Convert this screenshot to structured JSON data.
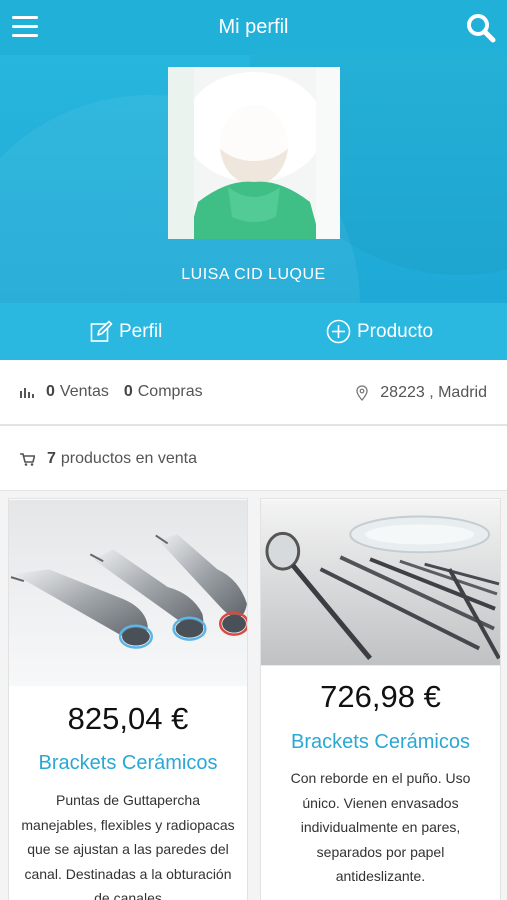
{
  "header": {
    "title": "Mi perfil"
  },
  "profile": {
    "name": "LUISA CID LUQUE"
  },
  "actions": {
    "perfil_label": "Perfil",
    "producto_label": "Producto"
  },
  "stats": {
    "ventas_count": "0",
    "ventas_label": "Ventas",
    "compras_count": "0",
    "compras_label": "Compras",
    "location": "28223 , Madrid"
  },
  "products_summary": {
    "count": "7",
    "label": "productos en venta"
  },
  "products": [
    {
      "price": "825,04 €",
      "title": "Brackets Cerámicos",
      "description": "Puntas de Guttapercha manejables, flexibles y radiopacas que se ajustan a las paredes del canal. Destinadas a la obturación de canales"
    },
    {
      "price": "726,98 €",
      "title": "Brackets Cerámicos",
      "description": "Con reborde en el puño. Uso único. Vienen envasados individualmente en pares, separados por papel antideslizante."
    }
  ],
  "icons": [
    "menu-icon",
    "search-icon",
    "edit-icon",
    "plus-circle-icon",
    "bar-chart-icon",
    "location-pin-icon",
    "cart-icon"
  ],
  "colors": {
    "primary": "#20b0d8",
    "action_bar": "#2bb8e0",
    "title_accent": "#2aa8d4"
  }
}
